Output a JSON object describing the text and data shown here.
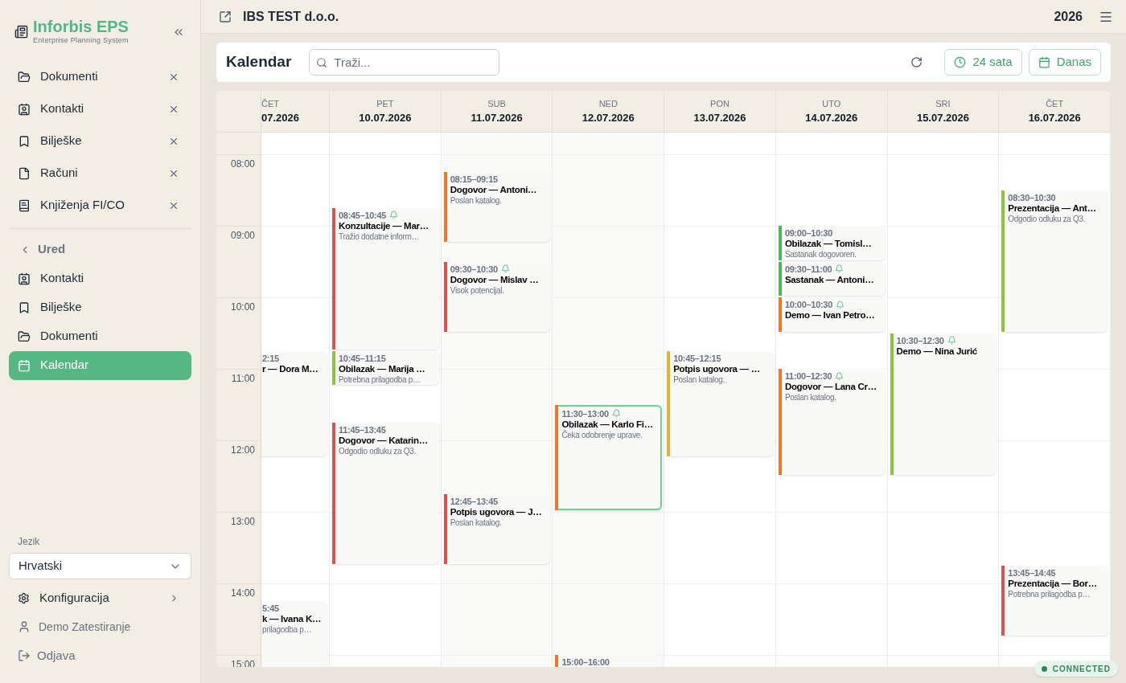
{
  "topbar": {
    "company": "IBS TEST d.o.o.",
    "year": "2026"
  },
  "sidebar": {
    "title": "Inforbis EPS",
    "subtitle": "Enterprise Planning System",
    "open_tabs": [
      {
        "label": "Dokumenti"
      },
      {
        "label": "Kontakti"
      },
      {
        "label": "Bilješke"
      },
      {
        "label": "Računi"
      },
      {
        "label": "Knjiženja FI/CO"
      }
    ],
    "section": "Ured",
    "nav_items": [
      {
        "label": "Kontakti",
        "selected": false
      },
      {
        "label": "Bilješke",
        "selected": false
      },
      {
        "label": "Dokumenti",
        "selected": false
      },
      {
        "label": "Kalendar",
        "selected": true
      }
    ],
    "language": {
      "label": "Jezik",
      "value": "Hrvatski"
    },
    "config": "Konfiguracija",
    "user": "Demo Zatestiranje",
    "logout": "Odjava"
  },
  "toolbar": {
    "title": "Kalendar",
    "search": {
      "placeholder": "Traži..."
    },
    "buttons": [
      "24 sata",
      "Danas"
    ]
  },
  "hours": [
    "08:00",
    "09:00",
    "10:00",
    "11:00",
    "12:00",
    "13:00",
    "14:00",
    "15:00"
  ],
  "days": [
    {
      "weekday": "ČET",
      "date": "07.2026",
      "partial": true,
      "weekend": false,
      "events": [
        {
          "time": "2:15",
          "bell": false,
          "title": "r — Dora M…",
          "selected": false
        },
        {
          "time": "5:45",
          "bell": false,
          "title": "k — Ivana K…",
          "note": "prilagodba p…",
          "selected": false
        }
      ]
    },
    {
      "weekday": "PET",
      "date": "10.07.2026",
      "partial": false,
      "weekend": false,
      "events": [
        {
          "time": "08:45–10:45",
          "bell": true,
          "title": "Konzultacije — Mar…",
          "note": "Tražio dodatne inform…",
          "color": "#e05252",
          "selected": false
        },
        {
          "time": "10:45–11:15",
          "bell": false,
          "title": "Obilazak — Marija …",
          "note": "Potrebna prilagodba p…",
          "color": "#8cc63f",
          "selected": false
        },
        {
          "time": "11:45–13:45",
          "bell": false,
          "title": "Dogovor — Katarin…",
          "note": "Odgodio odluku za Q3.",
          "color": "#e05252",
          "selected": false
        }
      ]
    },
    {
      "weekday": "SUB",
      "date": "11.07.2026",
      "partial": false,
      "weekend": true,
      "events": [
        {
          "time": "08:15–09:15",
          "bell": false,
          "title": "Dogovor — Antoni…",
          "note": "Poslan katalog.",
          "color": "#f07a2a",
          "selected": false
        },
        {
          "time": "09:30–10:30",
          "bell": true,
          "title": "Dogovor — Mislav …",
          "note": "Visok potencijal.",
          "color": "#e05252",
          "selected": false
        },
        {
          "time": "12:45–13:45",
          "bell": false,
          "title": "Potpis ugovora — J…",
          "note": "Poslan katalog.",
          "color": "#e05252",
          "selected": false
        }
      ]
    },
    {
      "weekday": "NED",
      "date": "12.07.2026",
      "partial": false,
      "weekend": true,
      "events": [
        {
          "time": "11:30–13:00",
          "bell": true,
          "title": "Obilazak — Karlo Fi…",
          "note": "Čeka odobrenje uprave.",
          "color": "#f07a2a",
          "selected": true
        },
        {
          "time": "15:00–16:00",
          "bell": false,
          "color": "#f07a2a",
          "selected": false
        }
      ]
    },
    {
      "weekday": "PON",
      "date": "13.07.2026",
      "partial": false,
      "weekend": false,
      "events": [
        {
          "time": "10:45–12:15",
          "bell": false,
          "title": "Potpis ugovora — …",
          "note": "Poslan katalog.",
          "color": "#e6b52e",
          "selected": false
        }
      ]
    },
    {
      "weekday": "UTO",
      "date": "14.07.2026",
      "partial": false,
      "weekend": false,
      "events": [
        {
          "time": "09:00–10:30",
          "bell": false,
          "title": "Obilazak — Tomisl…",
          "note": "Sastanak dogovoren.",
          "color": "#4cbb5a",
          "selected": false
        },
        {
          "time": "09:30–11:00",
          "bell": true,
          "title": "Sastanak — Antoni…",
          "color": "#4cbb5a",
          "selected": false
        },
        {
          "time": "10:00–10:30",
          "bell": true,
          "title": "Demo — Ivan Petro…",
          "color": "#f07a2a",
          "selected": false
        },
        {
          "time": "11:00–12:30",
          "bell": true,
          "title": "Dogovor — Lana Cr…",
          "note": "Poslan katalog.",
          "color": "#f07a2a",
          "selected": false
        }
      ]
    },
    {
      "weekday": "SRI",
      "date": "15.07.2026",
      "partial": false,
      "weekend": false,
      "events": [
        {
          "time": "10:30–12:30",
          "bell": true,
          "title": "Demo — Nina Jurić",
          "color": "#8cc63f",
          "selected": false
        }
      ]
    },
    {
      "weekday": "ČET",
      "date": "16.07.2026",
      "partial": false,
      "weekend": false,
      "events": [
        {
          "time": "08:30–10:30",
          "bell": false,
          "title": "Prezentacija — Ant…",
          "note": "Odgodio odluku za Q3.",
          "color": "#8cc63f",
          "selected": false
        },
        {
          "time": "13:45–14:45",
          "bell": false,
          "title": "Prezentacija — Bor…",
          "note": "Potrebna prilagodba p…",
          "color": "#e05252",
          "selected": false
        }
      ]
    }
  ],
  "status": {
    "label": "CONNECTED"
  }
}
